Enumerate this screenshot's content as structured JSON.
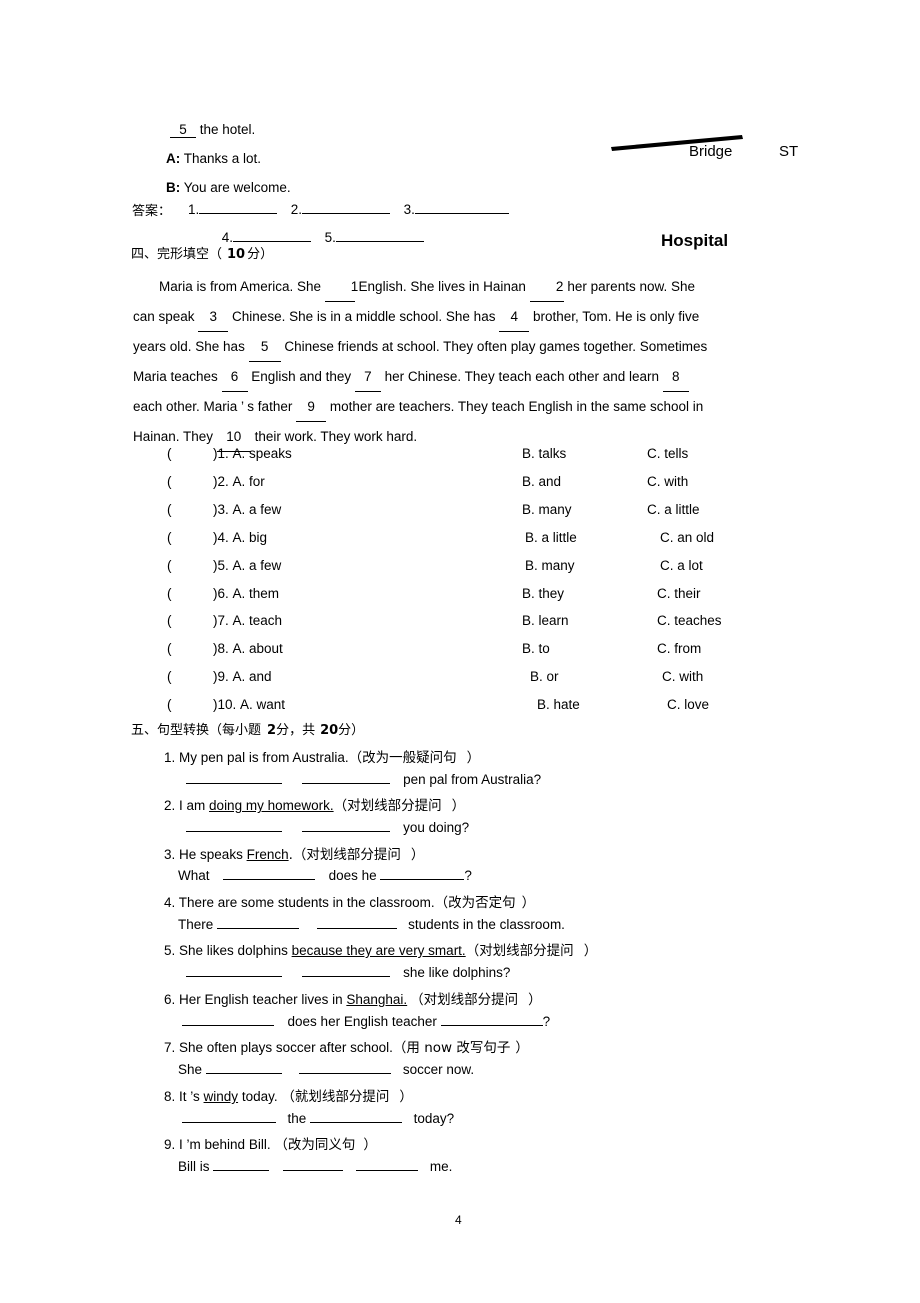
{
  "page": {
    "number": "4"
  },
  "dialogue": {
    "line_blank_number": "5",
    "line_tail": "the hotel.",
    "speaker_a_label": "A:",
    "speaker_a_text": "Thanks a lot.",
    "speaker_b_label": "B:",
    "speaker_b_text": "You are welcome.",
    "answers_label": "答案：",
    "answer_items": [
      "1.",
      "2.",
      "3.",
      "4.",
      "5."
    ]
  },
  "map": {
    "bridge_label": "Bridge",
    "street_label": "ST",
    "hospital_label": "Hospital"
  },
  "section4": {
    "heading_prefix": "四、完形填空（",
    "heading_score": "10",
    "heading_suffix": "分）",
    "passage": [
      {
        "parts": [
          {
            "t": "text",
            "v": "Maria is from America. She"
          },
          {
            "t": "blank",
            "v": "1"
          },
          {
            "t": "text",
            "v": "English. She lives in Hainan"
          },
          {
            "t": "blank",
            "v": "2"
          },
          {
            "t": "text",
            "v": "her parents now. She"
          }
        ]
      },
      {
        "parts": [
          {
            "t": "text",
            "v": "can speak"
          },
          {
            "t": "blank",
            "v": "3"
          },
          {
            "t": "text",
            "v": "Chinese. She is in a middle school. She has"
          },
          {
            "t": "blank",
            "v": "4"
          },
          {
            "t": "text",
            "v": "brother, Tom. He is only five"
          }
        ]
      },
      {
        "parts": [
          {
            "t": "text",
            "v": "years old. She has"
          },
          {
            "t": "blank",
            "v": "5"
          },
          {
            "t": "text",
            "v": "Chinese friends at school. They often play games together. Sometimes"
          }
        ]
      },
      {
        "parts": [
          {
            "t": "text",
            "v": "Maria  teaches"
          },
          {
            "t": "blank",
            "v": "6"
          },
          {
            "t": "text",
            "v": "English  and  they"
          },
          {
            "t": "blank",
            "v": "7"
          },
          {
            "t": "text",
            "v": "her  Chinese.  They  teach  each  other  and  learn"
          },
          {
            "t": "blank",
            "v": "8"
          }
        ]
      },
      {
        "parts": [
          {
            "t": "text",
            "v": "each  other.  Maria ’ s father"
          },
          {
            "t": "blank",
            "v": "9"
          },
          {
            "t": "text",
            "v": "mother  are teachers.  They  teach  English  in  the  same school  in"
          }
        ]
      },
      {
        "parts": [
          {
            "t": "text",
            "v": "Hainan. They"
          },
          {
            "t": "blank",
            "v": "10"
          },
          {
            "t": "text",
            "v": "their work. They work hard."
          }
        ]
      }
    ],
    "choices": [
      {
        "num": "1.",
        "a": "A. speaks",
        "b": "B. talks",
        "c": "C. tells"
      },
      {
        "num": "2.",
        "a": "A. for",
        "b": "B. and",
        "c": "C. with"
      },
      {
        "num": "3.",
        "a": "A. a few",
        "b": "B. many",
        "c": "C. a little"
      },
      {
        "num": "4.",
        "a": "A. big",
        "b": "B. a little",
        "c": "C. an old"
      },
      {
        "num": "5.",
        "a": "A. a few",
        "b": "B. many",
        "c": "C. a lot"
      },
      {
        "num": "6.",
        "a": "A. them",
        "b": "B. they",
        "c": "C. their"
      },
      {
        "num": "7.",
        "a": "A. teach",
        "b": "B. learn",
        "c": "C. teaches"
      },
      {
        "num": "8.",
        "a": "A. about",
        "b": "B. to",
        "c": "C. from"
      },
      {
        "num": "9.",
        "a": "A. and",
        "b": "B. or",
        "c": "C. with"
      },
      {
        "num": "10.",
        "a": "A. want",
        "b": "B. hate",
        "c": "C. love"
      }
    ]
  },
  "section5": {
    "heading_prefix": "五、句型转换（每小题",
    "heading_per": "2",
    "heading_mid": "分，共",
    "heading_total": "20",
    "heading_suffix": "分）",
    "items": [
      {
        "num": "1.",
        "stem_pre": "My pen pal is from Australia.（",
        "stem_instr": "改为一般疑问句",
        "stem_post": "）",
        "answer_tail": "pen pal from Australia?"
      },
      {
        "num": "2.",
        "stem_pre": "I am ",
        "stem_underlined": "doing my homework.",
        "stem_mid": "（",
        "stem_instr": "对划线部分提问",
        "stem_post": "）",
        "answer_tail": "you doing?"
      },
      {
        "num": "3.",
        "stem_pre": "He speaks ",
        "stem_underlined": "French",
        "stem_mid": ".（",
        "stem_instr": "对划线部分提问",
        "stem_post": "）",
        "answer_lead": "What",
        "answer_mid": "does he",
        "answer_tail": "?"
      },
      {
        "num": "4.",
        "stem_pre": "There are some students in the classroom.（",
        "stem_instr": "改为否定句",
        "stem_post": "）",
        "answer_lead": "There",
        "answer_tail": "students in the classroom."
      },
      {
        "num": "5.",
        "stem_pre": "She likes dolphins ",
        "stem_underlined": "because they are very smart.",
        "stem_mid": "（",
        "stem_instr": "对划线部分提问",
        "stem_post": "）",
        "answer_tail": "she like dolphins?"
      },
      {
        "num": "6.",
        "stem_pre": "Her English teacher lives in ",
        "stem_underlined": "Shanghai.",
        "stem_mid": "（",
        "stem_instr": "对划线部分提问",
        "stem_post": "）",
        "answer_mid": "does her English teacher",
        "answer_tail": "?"
      },
      {
        "num": "7.",
        "stem_pre": "She often plays soccer after school.（",
        "stem_instr": "用  now  改写句子",
        "stem_post": "）",
        "answer_lead": "She",
        "answer_tail": "soccer now."
      },
      {
        "num": "8.",
        "stem_pre": "It ’s ",
        "stem_underlined": "windy",
        "stem_mid": " today.      （",
        "stem_instr": "就划线部分提问",
        "stem_post": "）",
        "answer_mid": "the",
        "answer_tail": "today?"
      },
      {
        "num": "9.",
        "stem_pre": "I ’m behind Bill.     （",
        "stem_instr": "改为同义句",
        "stem_post": "）",
        "answer_lead": "Bill is",
        "answer_tail": "me."
      }
    ]
  }
}
